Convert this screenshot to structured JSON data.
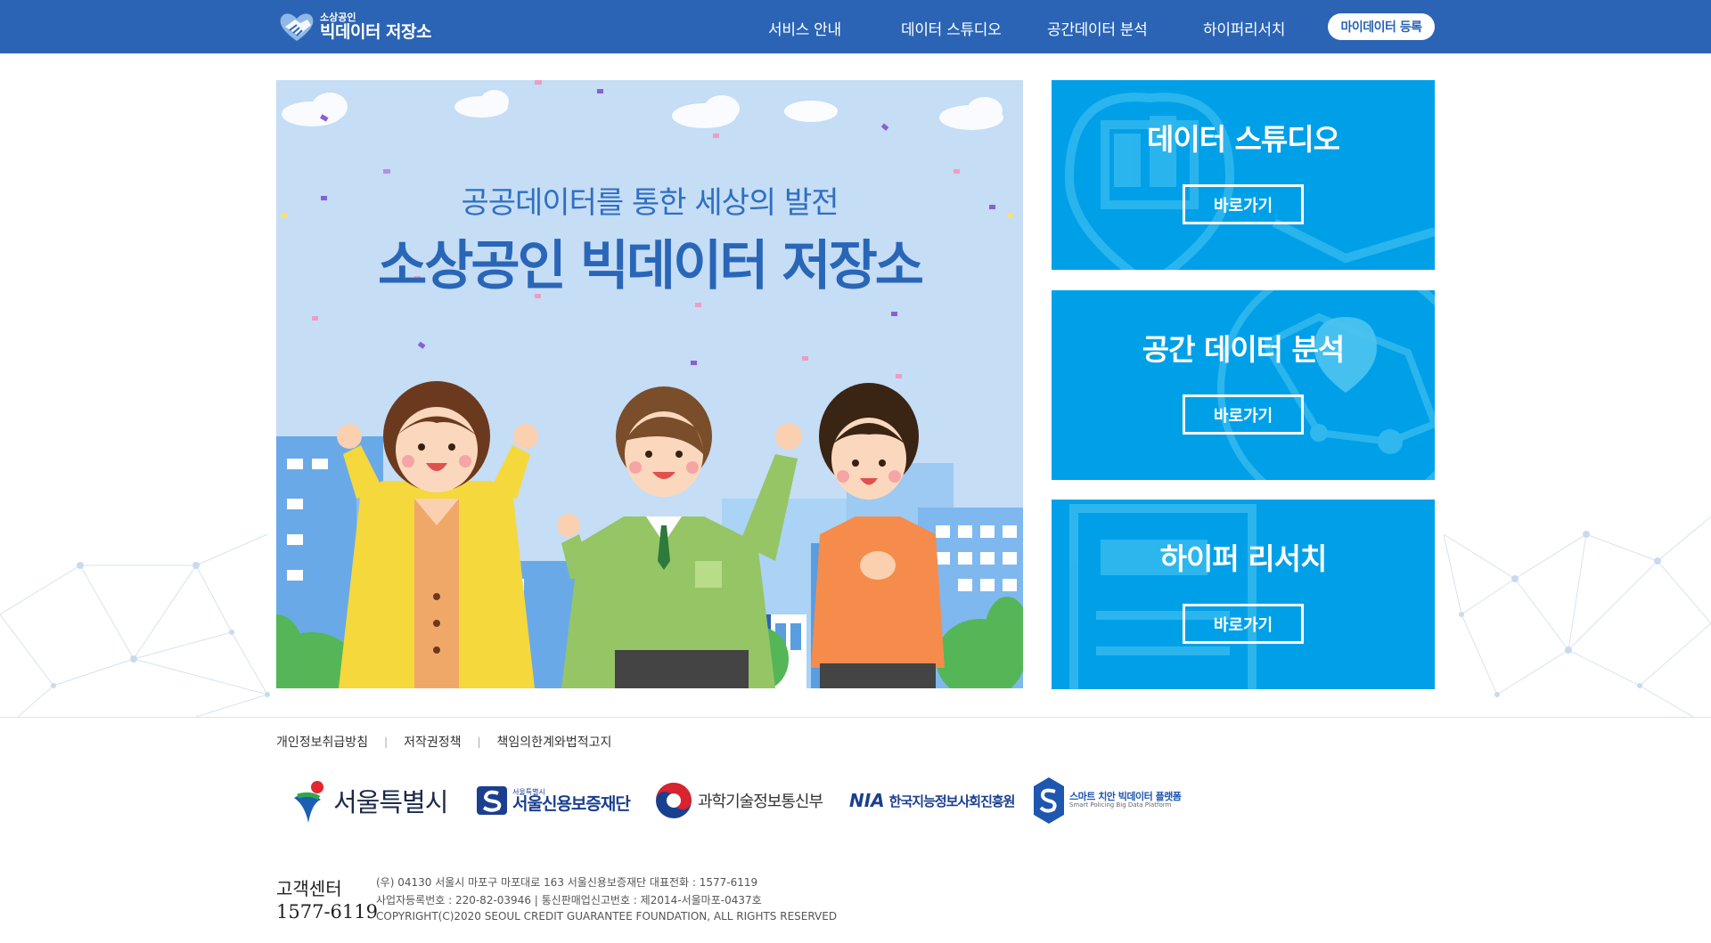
{
  "header": {
    "logo_small": "소상공인",
    "logo_big": "빅데이터 저장소",
    "nav": [
      "서비스 안내",
      "데이터 스튜디오",
      "공간데이터 분석",
      "하이퍼리서치"
    ],
    "mydata_button": "마이데이터 등록"
  },
  "banner": {
    "subtitle": "공공데이터를 통한 세상의 발전",
    "title": "소상공인 빅데이터 저장소"
  },
  "cards": [
    {
      "title": "데이터 스튜디오",
      "button": "바로가기"
    },
    {
      "title": "공간 데이터 분석",
      "button": "바로가기"
    },
    {
      "title": "하이퍼 리서치",
      "button": "바로가기"
    }
  ],
  "footer": {
    "links": [
      "개인정보취급방침",
      "저작권정책",
      "책임의한계와법적고지"
    ],
    "partners": {
      "seoul": "서울특별시",
      "sgf_small": "서울특별시",
      "sgf": "서울신용보증재단",
      "msit": "과학기술정보통신부",
      "nia_abbr": "NIA",
      "nia": "한국지능정보사회진흥원",
      "smart": "스마트 치안 빅데이터 플랫폼",
      "smart_en": "Smart Policing Big Data Platform"
    },
    "customer_center_label": "고객센터",
    "customer_center_phone": "1577-6119",
    "address_line1": "(우) 04130 서울시 마포구 마포대로 163 서울신용보증재단 대표전화 : 1577-6119",
    "address_line2": "사업자등록번호 : 220-82-03946 | 통신판매업신고번호 : 제2014-서울마포-0437호",
    "address_line3": "COPYRIGHT(C)2020 SEOUL CREDIT GUARANTEE FOUNDATION, ALL RIGHTS RESERVED"
  },
  "colors": {
    "header_blue": "#2b64b4",
    "card_blue": "#00a0e9",
    "banner_sky": "#c5ddf5"
  }
}
